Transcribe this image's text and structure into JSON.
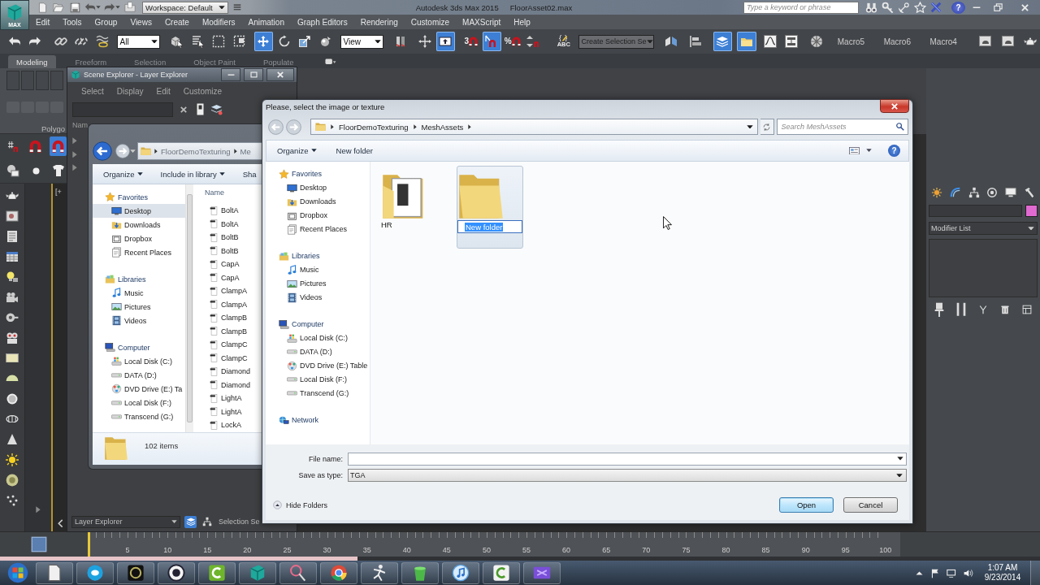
{
  "app": {
    "logo": "MAX",
    "workspace": "Workspace: Default",
    "title": "Autodesk 3ds Max 2015",
    "file": "FloorAsset02.max",
    "search": {
      "placeholder": "Type a keyword or phrase"
    },
    "help": "?"
  },
  "menu": [
    "Edit",
    "Tools",
    "Group",
    "Views",
    "Create",
    "Modifiers",
    "Animation",
    "Graph Editors",
    "Rendering",
    "Customize",
    "MAXScript",
    "Help"
  ],
  "main_toolbar": [
    {
      "kind": "tool",
      "active": false
    },
    {
      "kind": "tool",
      "active": false
    },
    {
      "kind": "tool",
      "active": false
    },
    {
      "kind": "tool",
      "active": false
    },
    {
      "kind": "tool",
      "active": false
    },
    {
      "kind": "dropdown",
      "value": "All"
    },
    {
      "kind": "tool",
      "active": false
    },
    {
      "kind": "tool",
      "active": false
    },
    {
      "kind": "tool",
      "active": false
    },
    {
      "kind": "tool",
      "active": false
    },
    {
      "kind": "tool",
      "active": true
    },
    {
      "kind": "tool",
      "active": false
    },
    {
      "kind": "tool",
      "active": false
    },
    {
      "kind": "tool",
      "active": false
    },
    {
      "kind": "dropdown",
      "value": "View"
    },
    {
      "kind": "tool",
      "active": false
    },
    {
      "kind": "tool",
      "active": false
    },
    {
      "kind": "tool",
      "active": true
    },
    {
      "kind": "tool",
      "active": false,
      "glyph": "3"
    },
    {
      "kind": "tool",
      "active": true
    },
    {
      "kind": "tool",
      "active": false,
      "glyph": "%"
    },
    {
      "kind": "tool",
      "active": false
    },
    {
      "kind": "tool",
      "active": false,
      "glyph": "ABC"
    },
    {
      "kind": "dropdown",
      "value": "Create Selection Se"
    },
    {
      "kind": "tool",
      "active": false
    },
    {
      "kind": "tool",
      "active": false
    },
    {
      "kind": "tool",
      "active": true
    },
    {
      "kind": "tool",
      "active": true
    },
    {
      "kind": "tool",
      "active": false
    },
    {
      "kind": "tool",
      "active": false
    },
    {
      "kind": "tool",
      "active": false
    },
    {
      "kind": "macro",
      "label": "Macro5"
    },
    {
      "kind": "macro",
      "label": "Macro6"
    },
    {
      "kind": "macro",
      "label": "Macro4"
    },
    {
      "kind": "tool",
      "active": false
    },
    {
      "kind": "tool",
      "active": false
    },
    {
      "kind": "tool",
      "active": false
    }
  ],
  "ribbon": {
    "tabs": [
      {
        "label": "Modeling",
        "selected": true
      },
      {
        "label": "Freeform",
        "selected": false
      },
      {
        "label": "Selection",
        "selected": false
      },
      {
        "label": "Object Paint",
        "selected": false
      },
      {
        "label": "Populate",
        "selected": false
      }
    ],
    "panel_label": "Polygo",
    "snap_tools": [
      {
        "active": false
      },
      {
        "active": false
      },
      {
        "active": true
      }
    ]
  },
  "viewport": {
    "label": "[+"
  },
  "scene_explorer": {
    "title": "Scene Explorer - Layer Explorer",
    "menu": [
      "Select",
      "Display",
      "Edit",
      "Customize"
    ],
    "column_1": "Nam",
    "explorer_type": "Layer Explorer",
    "mode_buttons": [
      {
        "active": true
      },
      {
        "active": false
      }
    ],
    "selection_set": "Selection Se"
  },
  "explorer_window": {
    "path": [
      "FloorDemoTexturing",
      "Me"
    ],
    "toolbar": [
      {
        "label": "Organize",
        "menu": true
      },
      {
        "label": "Include in library",
        "menu": true
      },
      {
        "label": "Sha",
        "menu": false
      }
    ],
    "nav": [
      {
        "label": "Favorites",
        "selected": false,
        "children": [
          {
            "label": "Desktop",
            "selected": true
          },
          {
            "label": "Downloads",
            "selected": false
          },
          {
            "label": "Dropbox",
            "selected": false
          },
          {
            "label": "Recent Places",
            "selected": false
          }
        ]
      },
      {
        "label": "Libraries",
        "selected": false,
        "children": [
          {
            "label": "Music",
            "selected": false
          },
          {
            "label": "Pictures",
            "selected": false
          },
          {
            "label": "Videos",
            "selected": false
          }
        ]
      },
      {
        "label": "Computer",
        "selected": false,
        "children": [
          {
            "label": "Local Disk (C:)",
            "selected": false
          },
          {
            "label": "DATA (D:)",
            "selected": false
          },
          {
            "label": "DVD Drive (E:) Ta",
            "selected": false
          },
          {
            "label": "Local Disk (F:)",
            "selected": false
          },
          {
            "label": "Transcend (G:)",
            "selected": false
          }
        ]
      }
    ],
    "column_1": "Name",
    "files": [
      "BoltA",
      "BoltA",
      "BoltB",
      "BoltB",
      "CapA",
      "CapA",
      "ClampA",
      "ClampA",
      "ClampB",
      "ClampB",
      "ClampC",
      "ClampC",
      "Diamond",
      "Diamond",
      "LightA",
      "LightA",
      "LockA"
    ],
    "status": "102 items"
  },
  "dialog": {
    "title": "Please, select the image or texture",
    "path": [
      "FloorDemoTexturing",
      "MeshAssets"
    ],
    "search": {
      "placeholder": "Search MeshAssets"
    },
    "toolbar": [
      {
        "label": "Organize",
        "menu": true
      },
      {
        "label": "New folder",
        "menu": false
      }
    ],
    "help": "?",
    "nav": [
      {
        "label": "Favorites",
        "selected": false,
        "children": [
          {
            "label": "Desktop",
            "selected": false
          },
          {
            "label": "Downloads",
            "selected": false
          },
          {
            "label": "Dropbox",
            "selected": false
          },
          {
            "label": "Recent Places",
            "selected": false
          }
        ]
      },
      {
        "label": "Libraries",
        "selected": false,
        "children": [
          {
            "label": "Music",
            "selected": false
          },
          {
            "label": "Pictures",
            "selected": false
          },
          {
            "label": "Videos",
            "selected": false
          }
        ]
      },
      {
        "label": "Computer",
        "selected": false,
        "children": [
          {
            "label": "Local Disk (C:)",
            "selected": false
          },
          {
            "label": "DATA (D:)",
            "selected": false
          },
          {
            "label": "DVD Drive (E:) Table",
            "selected": false
          },
          {
            "label": "Local Disk (F:)",
            "selected": false
          },
          {
            "label": "Transcend (G:)",
            "selected": false
          }
        ]
      },
      {
        "label": "Network",
        "selected": false
      }
    ],
    "items": [
      {
        "name": "HR",
        "filled": true,
        "selected": false,
        "renaming": false
      },
      {
        "name": "New folder",
        "filled": false,
        "selected": true,
        "renaming": true
      }
    ],
    "file_name": {
      "label": "File name:"
    },
    "file_type": {
      "label": "Save as type:",
      "value": "TGA"
    },
    "hide_folders": "Hide Folders",
    "buttons": [
      {
        "label": "Open",
        "default": true
      },
      {
        "label": "Cancel",
        "default": false
      }
    ]
  },
  "command_panel": {
    "modifier_list": "Modifier List"
  },
  "timeline": {
    "ticks": [
      "5",
      "10",
      "15",
      "20",
      "25",
      "30",
      "35",
      "40",
      "45",
      "50",
      "55",
      "60",
      "65",
      "70",
      "75",
      "80",
      "85",
      "90",
      "95",
      "100"
    ]
  },
  "taskbar": {
    "time": "1:07 AM",
    "date": "9/23/2014"
  }
}
